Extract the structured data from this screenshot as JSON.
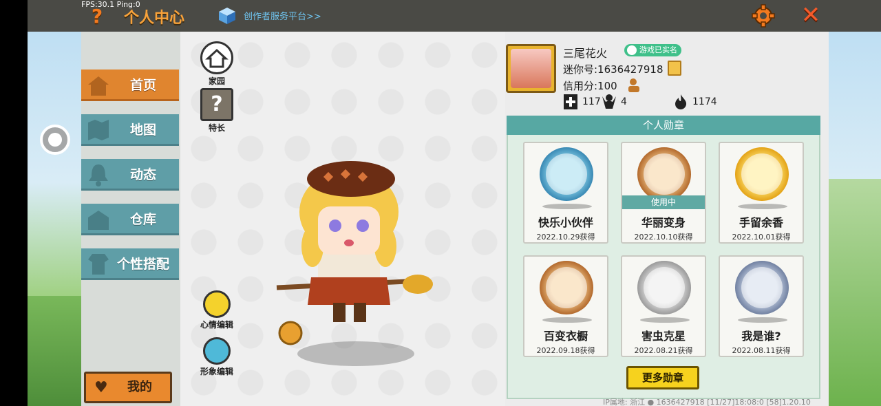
{
  "overlay": {
    "fps": "FPS:30.1  Ping:0"
  },
  "header": {
    "title": "个人中心",
    "creator_link": "创作者服务平台>>",
    "help_icon": "question-icon",
    "settings_icon": "gear-icon",
    "close_icon": "close-x-icon"
  },
  "sidebar": {
    "items": [
      {
        "label": "首页",
        "icon": "house-icon",
        "active": true
      },
      {
        "label": "地图",
        "icon": "map-icon",
        "active": false
      },
      {
        "label": "动态",
        "icon": "bell-icon",
        "active": false
      },
      {
        "label": "仓库",
        "icon": "warehouse-icon",
        "active": false
      },
      {
        "label": "个性搭配",
        "icon": "outfit-icon",
        "active": false
      }
    ],
    "my_button": "我的"
  },
  "showcase": {
    "home_label": "家园",
    "talent_label": "特长",
    "mood_label": "心情编辑",
    "appearance_label": "形象编辑"
  },
  "profile": {
    "nickname": "三尾花火",
    "verified": "游戏已实名",
    "mini_id": "迷你号:1636427918",
    "credit": "信用分:100",
    "stats": {
      "likes": "117",
      "followers": "4",
      "heat": "1174"
    }
  },
  "badges": {
    "title": "个人勋章",
    "in_use_label": "使用中",
    "items": [
      {
        "name": "快乐小伙伴",
        "date": "2022.10.29获得",
        "style": "blue"
      },
      {
        "name": "华丽变身",
        "date": "2022.10.10获得",
        "style": "bronze",
        "in_use": true
      },
      {
        "name": "手留余香",
        "date": "2022.10.01获得",
        "style": "gold"
      },
      {
        "name": "百变衣橱",
        "date": "2022.09.18获得",
        "style": "bronze"
      },
      {
        "name": "害虫克星",
        "date": "2022.08.21获得",
        "style": "silver"
      },
      {
        "name": "我是谁?",
        "date": "2022.08.11获得",
        "style": "steel"
      }
    ],
    "more_button": "更多勋章"
  },
  "footer": {
    "info": "IP属地: 浙江  ●   1636427918   [11/27]18:08:0  [58]1.20.10"
  },
  "colors": {
    "accent_orange": "#e0852f",
    "tab_teal": "#5f9ea7",
    "badge_header": "#57a8a3",
    "more_button": "#f6d21e"
  }
}
